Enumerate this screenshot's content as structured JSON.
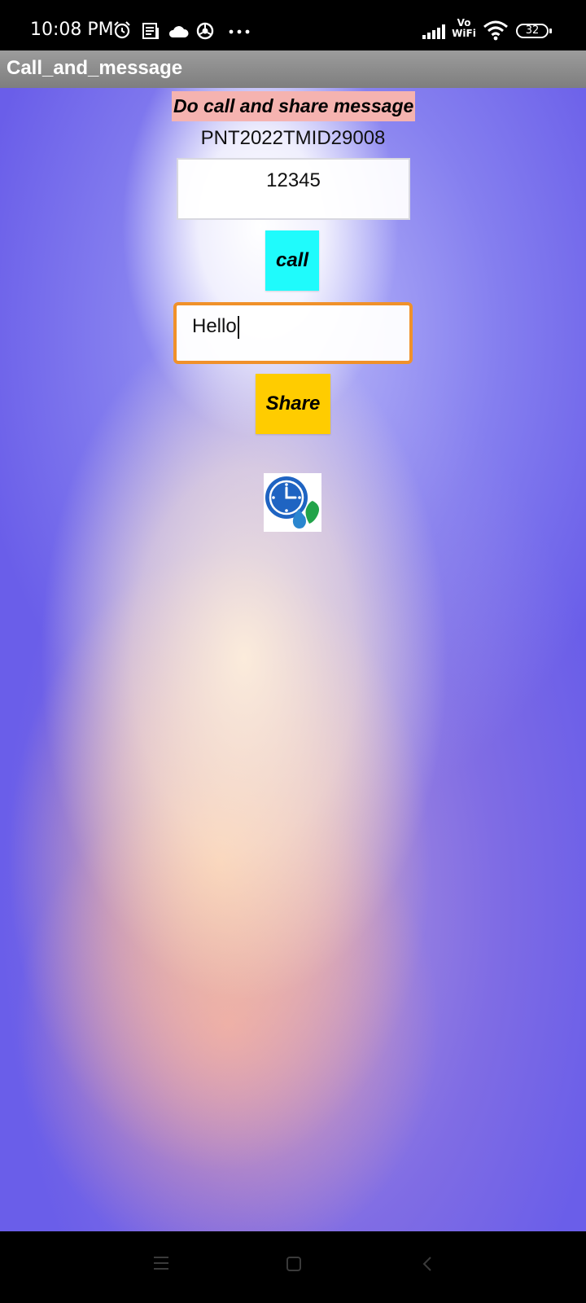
{
  "status_bar": {
    "time": "10:08 PM",
    "network_label": "Vo WiFi",
    "network_label_top": "Vo",
    "network_label_bottom": "WiFi",
    "battery": "32"
  },
  "app_bar": {
    "title": "Call_and_message"
  },
  "main": {
    "heading": "Do call and share message",
    "project_id": "PNT2022TMID29008",
    "phone_number": "12345",
    "call_label": "call",
    "message_value": "Hello",
    "share_label": "Share"
  },
  "colors": {
    "heading_bg": "#f5b3b0",
    "call_bg": "#1ffbfc",
    "share_bg": "#ffcc00",
    "focus_border": "#f0912a",
    "app_bar_bg": "#8f8f8f"
  },
  "icons": {
    "alarm": "alarm-icon",
    "news": "news-icon",
    "cloud": "cloud-icon",
    "chrome": "chrome-icon",
    "more": "more-dots-icon",
    "signal": "signal-icon",
    "wifi": "wifi-icon",
    "logo": "clock-water-logo",
    "nav_menu": "menu-icon",
    "nav_home": "home-icon",
    "nav_back": "back-icon"
  }
}
